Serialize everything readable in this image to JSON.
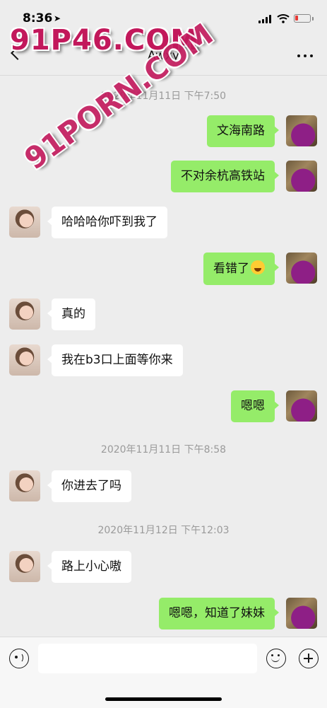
{
  "status_bar": {
    "time": "8:36",
    "location_arrow": "location-arrow-icon",
    "battery_level": 0.15,
    "battery_color": "#e53935"
  },
  "nav": {
    "title": "Awxy",
    "back_icon": "chevron-left-icon",
    "more_icon": "more-dots-icon"
  },
  "watermarks": [
    "91P46.COM",
    "91PORN.COM"
  ],
  "messages": [
    {
      "type": "timestamp",
      "text": "2020年11月11日 下午7:50"
    },
    {
      "type": "msg",
      "side": "self",
      "text": "文海南路"
    },
    {
      "type": "msg",
      "side": "self",
      "text": "不对余杭高铁站"
    },
    {
      "type": "msg",
      "side": "other",
      "text": "哈哈哈你吓到我了"
    },
    {
      "type": "msg",
      "side": "self",
      "text": "看错了",
      "emoji": "laughing-crying-emoji"
    },
    {
      "type": "msg",
      "side": "other",
      "text": "真的"
    },
    {
      "type": "msg",
      "side": "other",
      "text": "我在b3口上面等你来"
    },
    {
      "type": "msg",
      "side": "self",
      "text": "嗯嗯"
    },
    {
      "type": "timestamp",
      "text": "2020年11月11日 下午8:58"
    },
    {
      "type": "msg",
      "side": "other",
      "text": "你进去了吗"
    },
    {
      "type": "timestamp",
      "text": "2020年11月12日 下午12:03"
    },
    {
      "type": "msg",
      "side": "other",
      "text": "路上小心嗷"
    },
    {
      "type": "msg",
      "side": "self",
      "text": "嗯嗯，知道了妹妹"
    }
  ],
  "input_bar": {
    "placeholder": "",
    "voice_icon": "voice-icon",
    "emoji_icon": "emoji-icon",
    "plus_icon": "plus-icon"
  },
  "colors": {
    "background": "#ededed",
    "self_bubble": "#95ec69",
    "other_bubble": "#ffffff",
    "timestamp": "#9a9a9a",
    "watermark": "#c2185b"
  }
}
